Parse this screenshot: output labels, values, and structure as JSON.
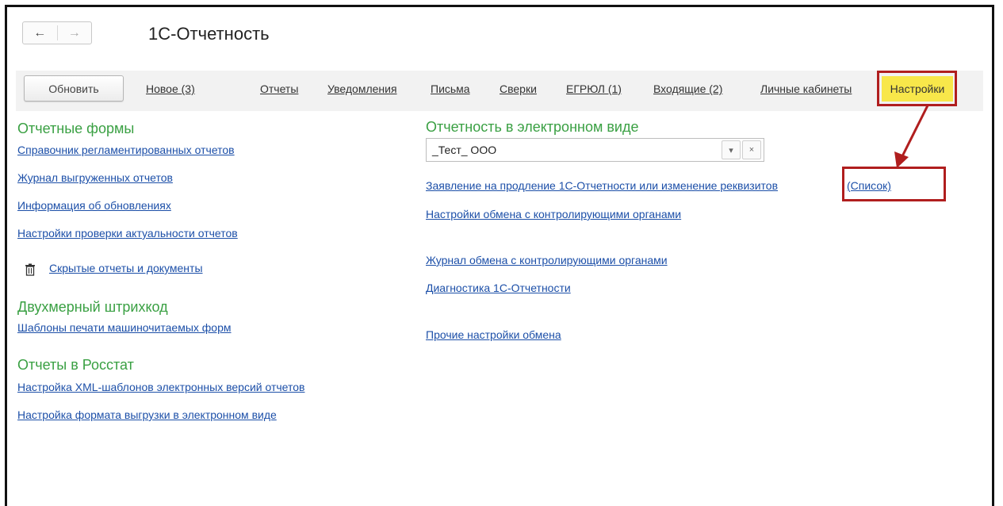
{
  "window": {
    "title": "1С-Отчетность"
  },
  "nav": {
    "back": "←",
    "forward": "→"
  },
  "toolbar": {
    "refresh_label": "Обновить",
    "tabs": [
      "Новое (3)",
      "Отчеты",
      "Уведомления",
      "Письма",
      "Сверки",
      "ЕГРЮЛ (1)",
      "Входящие (2)",
      "Личные кабинеты"
    ],
    "active_tab": "Настройки"
  },
  "left": {
    "report_forms": {
      "title": "Отчетные формы",
      "links": [
        "Справочник регламентированных отчетов",
        "Журнал выгруженных отчетов",
        "Информация об обновлениях",
        "Настройки проверки актуальности отчетов"
      ],
      "hidden_docs": "Скрытые отчеты и документы"
    },
    "barcode": {
      "title": "Двухмерный штрихкод",
      "links": [
        "Шаблоны печати машиночитаемых форм"
      ]
    },
    "rosstat": {
      "title": "Отчеты в Росстат",
      "links": [
        "Настройка XML-шаблонов электронных версий отчетов",
        "Настройка формата выгрузки в электронном виде"
      ]
    }
  },
  "right": {
    "title": "Отчетность в электронном виде",
    "org_select": {
      "value": "_Тест_ ООО",
      "dropdown_glyph": "▾",
      "clear_glyph": "×"
    },
    "application_link": "Заявление на продление 1С-Отчетности или изменение реквизитов",
    "list_link": "(Список)",
    "links": [
      "Настройки обмена с контролирующими органами",
      "Журнал обмена с контролирующими органами",
      "Диагностика 1С-Отчетности",
      "Прочие настройки обмена"
    ]
  },
  "colors": {
    "accent_green": "#3aa043",
    "link_blue": "#1c4fa8",
    "highlight_yellow": "#f8e74a",
    "callout_red": "#b01e1e"
  },
  "icons": {
    "trash": "trash-icon",
    "arrow": "annotation-arrow"
  }
}
